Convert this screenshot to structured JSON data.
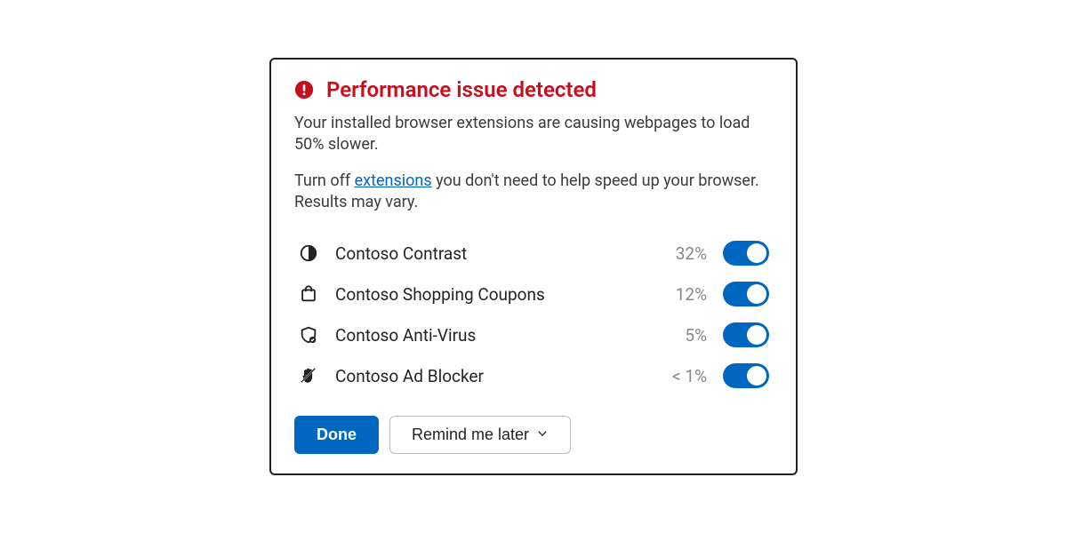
{
  "title": "Performance issue detected",
  "body": {
    "line1": "Your installed browser extensions are causing webpages to load 50% slower.",
    "line2a": "Turn off ",
    "link": "extensions",
    "line2b": " you don't need to help speed up your browser. Results may vary."
  },
  "extensions": [
    {
      "name": "Contoso Contrast",
      "impact": "32%",
      "enabled": true,
      "icon": "contrast"
    },
    {
      "name": "Contoso Shopping Coupons",
      "impact": "12%",
      "enabled": true,
      "icon": "shopping"
    },
    {
      "name": "Contoso Anti-Virus",
      "impact": "5%",
      "enabled": true,
      "icon": "shield"
    },
    {
      "name": "Contoso Ad Blocker",
      "impact": "< 1%",
      "enabled": true,
      "icon": "block-hand"
    }
  ],
  "buttons": {
    "done": "Done",
    "remind": "Remind me later"
  }
}
